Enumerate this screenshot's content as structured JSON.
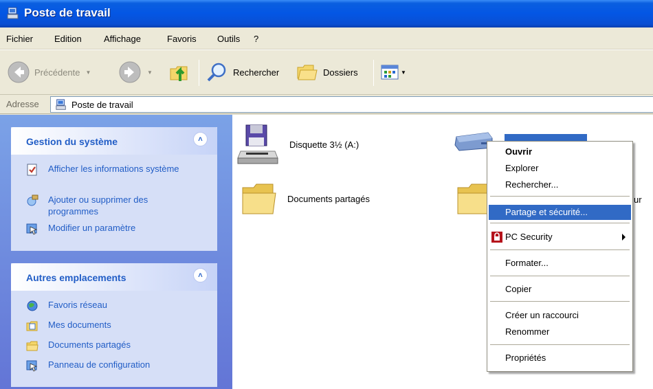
{
  "window": {
    "title": "Poste de travail"
  },
  "menu": [
    "Fichier",
    "Edition",
    "Affichage",
    "Favoris",
    "Outils",
    "?"
  ],
  "toolbar": {
    "back_label": "Précédente",
    "search_label": "Rechercher",
    "folders_label": "Dossiers"
  },
  "address": {
    "label": "Adresse",
    "value": "Poste de travail"
  },
  "tasks_system": {
    "title": "Gestion du système",
    "items": [
      "Afficher les informations système",
      "Ajouter ou supprimer des programmes",
      "Modifier un paramètre"
    ]
  },
  "tasks_places": {
    "title": "Autres emplacements",
    "items": [
      "Favoris réseau",
      "Mes documents",
      "Documents partagés",
      "Panneau de configuration"
    ]
  },
  "items": {
    "floppy": "Disquette 3½ (A:)",
    "shared_docs": "Documents partagés",
    "partial_text": "ur"
  },
  "context_menu": {
    "items": [
      "Ouvrir",
      "Explorer",
      "Rechercher...",
      "Partage et sécurité...",
      "PC Security",
      "Formater...",
      "Copier",
      "Créer un raccourci",
      "Renommer",
      "Propriétés"
    ],
    "highlighted": "Partage et sécurité..."
  },
  "colors": {
    "title_bar": "#0456e4",
    "highlight": "#316ac5",
    "link": "#215dc6"
  }
}
